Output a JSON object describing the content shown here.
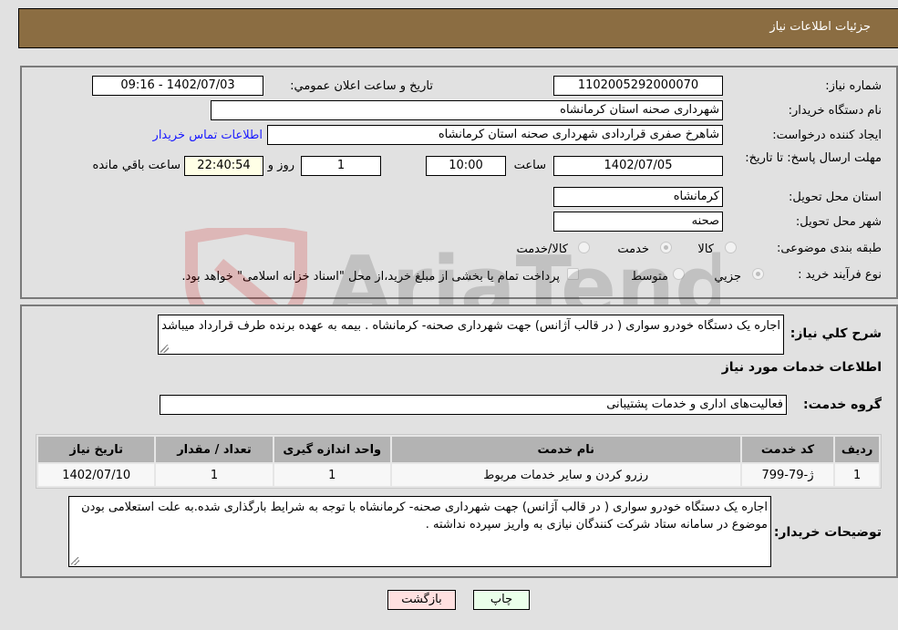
{
  "header": {
    "title": "جزئیات اطلاعات نیاز"
  },
  "details": {
    "need_number": {
      "label": "شماره نیاز:",
      "value": "1102005292000070"
    },
    "announce_datetime": {
      "label": "تاریخ و ساعت اعلان عمومي:",
      "value": "1402/07/03 - 09:16"
    },
    "buyer_org": {
      "label": "نام دستگاه خریدار:",
      "value": "شهرداری صحنه استان کرمانشاه"
    },
    "requester": {
      "label": "ایجاد کننده درخواست:",
      "value": "شاهرخ صفری قراردادی شهرداری صحنه استان کرمانشاه",
      "contact_link": "اطلاعات تماس خریدار"
    },
    "deadline": {
      "label": "مهلت ارسال پاسخ: تا تاریخ:",
      "date": "1402/07/05",
      "time_label": "ساعت",
      "time": "10:00",
      "days": "1",
      "days_label": "روز و",
      "remaining": "22:40:54",
      "remaining_label": "ساعت باقي مانده"
    },
    "delivery_province": {
      "label": "استان محل تحویل:",
      "value": "کرمانشاه"
    },
    "delivery_city": {
      "label": "شهر محل تحویل:",
      "value": "صحنه"
    },
    "category": {
      "label": "طبقه بندی موضوعی:",
      "options": [
        "کالا",
        "خدمت",
        "کالا/خدمت"
      ],
      "selected": "خدمت"
    },
    "purchase_type": {
      "label": "نوع فرآیند خرید :",
      "options": [
        "جزيي",
        "متوسط"
      ],
      "selected": "جزيي",
      "treasury_checkbox_label": "پرداخت تمام یا بخشی از مبلغ خرید،از محل \"اسناد خزانه اسلامی\" خواهد بود.",
      "treasury_checked": false
    }
  },
  "description": {
    "label": "شرح کلي نیاز:",
    "value": "اجاره یک دستگاه خودرو سواری ( در قالب آژانس) جهت شهرداری صحنه- کرمانشاه  . بیمه به عهده برنده طرف قرارداد میباشد"
  },
  "services": {
    "section_title": "اطلاعات خدمات مورد نیاز",
    "group_label": "گروه خدمت:",
    "group_value": "فعالیت‌های اداری و خدمات پشتیبانی",
    "table": {
      "headers": [
        "ردیف",
        "کد خدمت",
        "نام خدمت",
        "واحد اندازه گیری",
        "تعداد / مقدار",
        "تاریخ نیاز"
      ],
      "rows": [
        [
          "1",
          "ژ-79-799",
          "رزرو کردن و سایر خدمات مربوط",
          "1",
          "1",
          "1402/07/10"
        ]
      ]
    }
  },
  "buyer_notes": {
    "label": "توضیحات خریدار:",
    "value": "اجاره یک دستگاه خودرو سواری ( در قالب آژانس) جهت شهرداری صحنه- کرمانشاه  با توجه به شرایط بارگذاری شده.به علت استعلامی بودن موضوع در سامانه ستاد شرکت کنندگان نیازی به واریز سپرده نداشته ."
  },
  "buttons": {
    "print": "چاپ",
    "back": "بازگشت"
  },
  "colors": {
    "header_bg": "#8b6d42",
    "print_bg": "#eaffea",
    "back_bg": "#ffe0e0",
    "link": "#1a1aff"
  },
  "watermark": {
    "text": "AriaTender.neT"
  }
}
